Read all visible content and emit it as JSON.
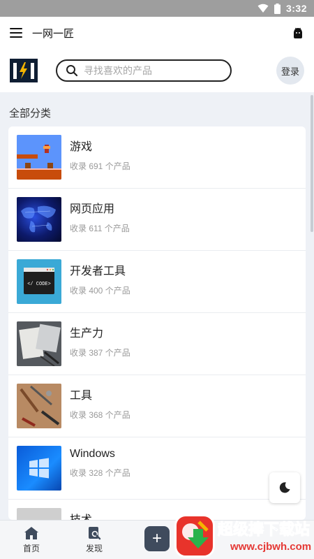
{
  "status_bar": {
    "time": "3:32"
  },
  "app_bar": {
    "title": "一网一匠"
  },
  "header": {
    "search_placeholder": "寻找喜欢的产品",
    "login_label": "登录"
  },
  "section_title": "全部分类",
  "categories": [
    {
      "name": "游戏",
      "count": "收录 691 个产品"
    },
    {
      "name": "网页应用",
      "count": "收录 611 个产品"
    },
    {
      "name": "开发者工具",
      "count": "收录 400 个产品"
    },
    {
      "name": "生产力",
      "count": "收录 387 个产品"
    },
    {
      "name": "工具",
      "count": "收录 368 个产品"
    },
    {
      "name": "Windows",
      "count": "收录 328 个产品"
    },
    {
      "name": "技术",
      "count": ""
    }
  ],
  "thumb_code_text": "</ CODE>",
  "bottom_nav": {
    "home_label": "首页",
    "discover_label": "发现"
  },
  "watermark": {
    "title": "超级捧下载站",
    "url": "www.cjbwh.com"
  },
  "colors": {
    "accent_dark": "#3f4b5d",
    "status_bar": "#9e9e9e",
    "page_bg": "#eef1f6"
  }
}
